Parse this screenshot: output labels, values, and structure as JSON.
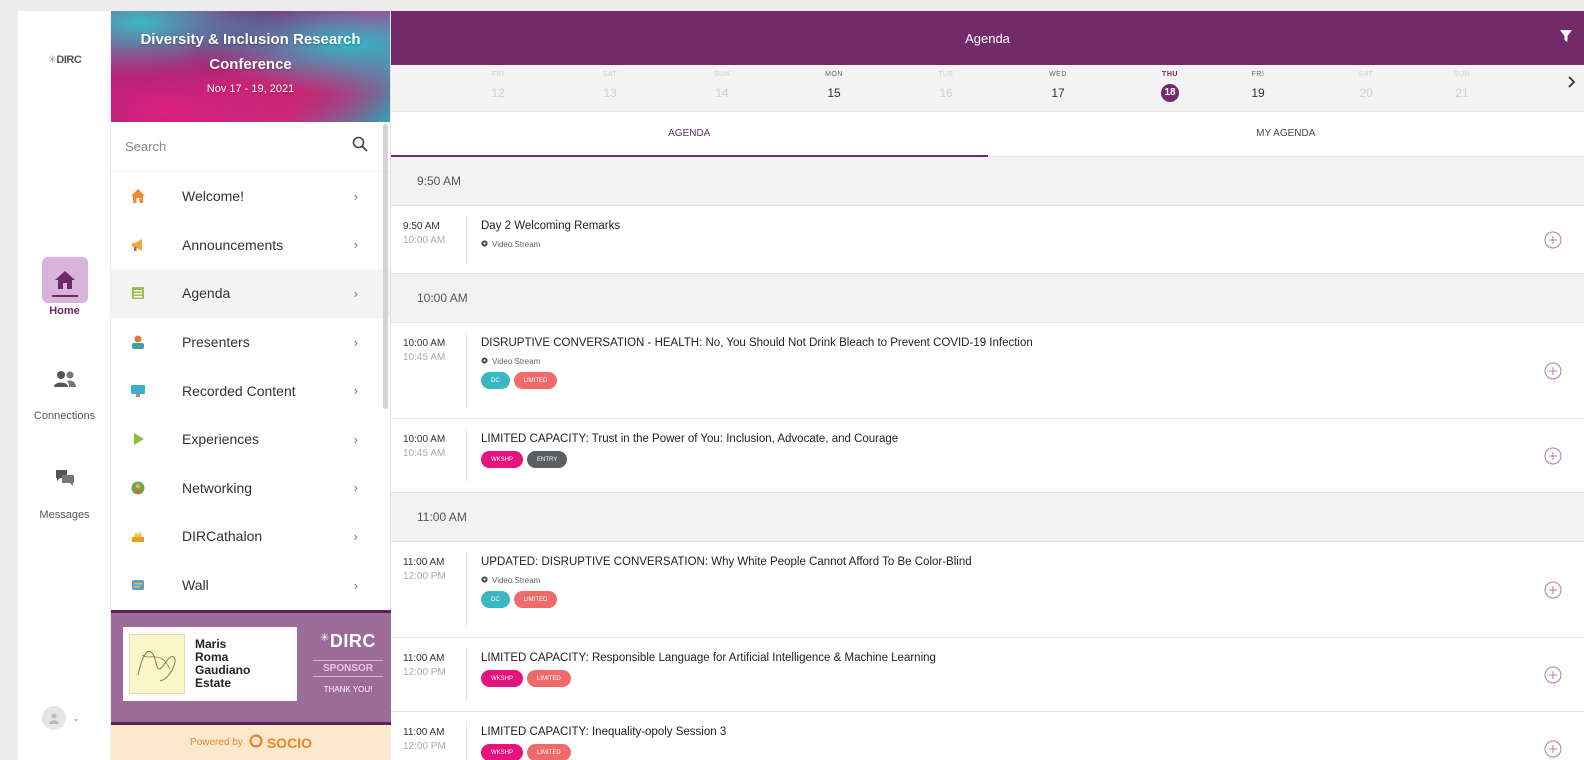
{
  "rail": {
    "logo": "DIRC",
    "items": [
      {
        "label": "Home"
      },
      {
        "label": "Connections"
      },
      {
        "label": "Messages"
      }
    ]
  },
  "menu": {
    "banner": {
      "title_line1": "Diversity & Inclusion Research",
      "title_line2": "Conference",
      "dates": "Nov 17 - 19, 2021"
    },
    "search_placeholder": "Search",
    "items": [
      {
        "label": "Welcome!",
        "icon": "home-icon",
        "color": "#f08a3a"
      },
      {
        "label": "Announcements",
        "icon": "megaphone-icon",
        "color": "#f0a93a"
      },
      {
        "label": "Agenda",
        "icon": "calendar-list-icon",
        "color": "#9bc04c"
      },
      {
        "label": "Presenters",
        "icon": "presenter-icon",
        "color": "#3aa6a0"
      },
      {
        "label": "Recorded Content",
        "icon": "monitor-icon",
        "color": "#3ab0c9"
      },
      {
        "label": "Experiences",
        "icon": "play-icon",
        "color": "#8fbf3a"
      },
      {
        "label": "Networking",
        "icon": "networking-icon",
        "color": "#6aa84f"
      },
      {
        "label": "DIRCathalon",
        "icon": "trophy-icon",
        "color": "#e8a020"
      },
      {
        "label": "Wall",
        "icon": "wall-icon",
        "color": "#5aa0c9"
      }
    ],
    "sponsor": {
      "name_lines": [
        "Maris",
        "Roma",
        "Gaudiano",
        "Estate"
      ],
      "brand": "DIRC",
      "label": "SPONSOR",
      "thanks": "THANK YOU!"
    },
    "powered_by": "Powered by",
    "powered_brand": "SOCIO"
  },
  "main": {
    "title": "Agenda",
    "days": [
      {
        "name": "FRI",
        "date": "12",
        "enabled": false
      },
      {
        "name": "SAT",
        "date": "13",
        "enabled": false
      },
      {
        "name": "SUN",
        "date": "14",
        "enabled": false
      },
      {
        "name": "MON",
        "date": "15",
        "enabled": true
      },
      {
        "name": "TUE",
        "date": "16",
        "enabled": false
      },
      {
        "name": "WED",
        "date": "17",
        "enabled": true
      },
      {
        "name": "THU",
        "date": "18",
        "enabled": true,
        "selected": true
      },
      {
        "name": "FRI",
        "date": "19",
        "enabled": true
      },
      {
        "name": "SAT",
        "date": "20",
        "enabled": false
      },
      {
        "name": "SUN",
        "date": "21",
        "enabled": false
      }
    ],
    "tabs": [
      {
        "label": "AGENDA",
        "active": true
      },
      {
        "label": "MY AGENDA",
        "active": false
      }
    ],
    "slots": [
      {
        "time": "9:50 AM",
        "sessions": [
          {
            "start": "9:50 AM",
            "end": "10:00 AM",
            "title": "Day 2 Welcoming Remarks",
            "location": "Video Stream",
            "tags": []
          }
        ]
      },
      {
        "time": "10:00 AM",
        "sessions": [
          {
            "start": "10:00 AM",
            "end": "10:45 AM",
            "title": "DISRUPTIVE CONVERSATION - HEALTH: No, You Should Not Drink Bleach to Prevent COVID-19 Infection",
            "location": "Video Stream",
            "tags": [
              {
                "label": "DC",
                "color": "#3bb7c4"
              },
              {
                "label": "LIMITED",
                "color": "#ef6b6b"
              }
            ]
          },
          {
            "start": "10:00 AM",
            "end": "10:45 AM",
            "title": "LIMITED CAPACITY: Trust in the Power of You: Inclusion, Advocate, and Courage",
            "location": "",
            "tags": [
              {
                "label": "WKSHP",
                "color": "#e5137e"
              },
              {
                "label": "ENTRY",
                "color": "#5a5f63"
              }
            ]
          }
        ]
      },
      {
        "time": "11:00 AM",
        "sessions": [
          {
            "start": "11:00 AM",
            "end": "12:00 PM",
            "title": "UPDATED: DISRUPTIVE CONVERSATION: Why White People Cannot Afford To Be Color-Blind",
            "location": "Video Stream",
            "tags": [
              {
                "label": "DC",
                "color": "#3bb7c4"
              },
              {
                "label": "LIMITED",
                "color": "#ef6b6b"
              }
            ]
          },
          {
            "start": "11:00 AM",
            "end": "12:00 PM",
            "title": "LIMITED CAPACITY: Responsible Language for Artificial Intelligence & Machine Learning",
            "location": "",
            "tags": [
              {
                "label": "WKSHP",
                "color": "#e5137e"
              },
              {
                "label": "LIMITED",
                "color": "#ef6b6b"
              }
            ]
          },
          {
            "start": "11:00 AM",
            "end": "12:00 PM",
            "title": "LIMITED CAPACITY: Inequality-opoly Session 3",
            "location": "",
            "tags": [
              {
                "label": "WKSHP",
                "color": "#e5137e"
              },
              {
                "label": "LIMITED",
                "color": "#ef6b6b"
              }
            ]
          }
        ]
      }
    ]
  },
  "colors": {
    "accent": "#722a6a",
    "rail_active_bg": "#d8b4dd"
  }
}
